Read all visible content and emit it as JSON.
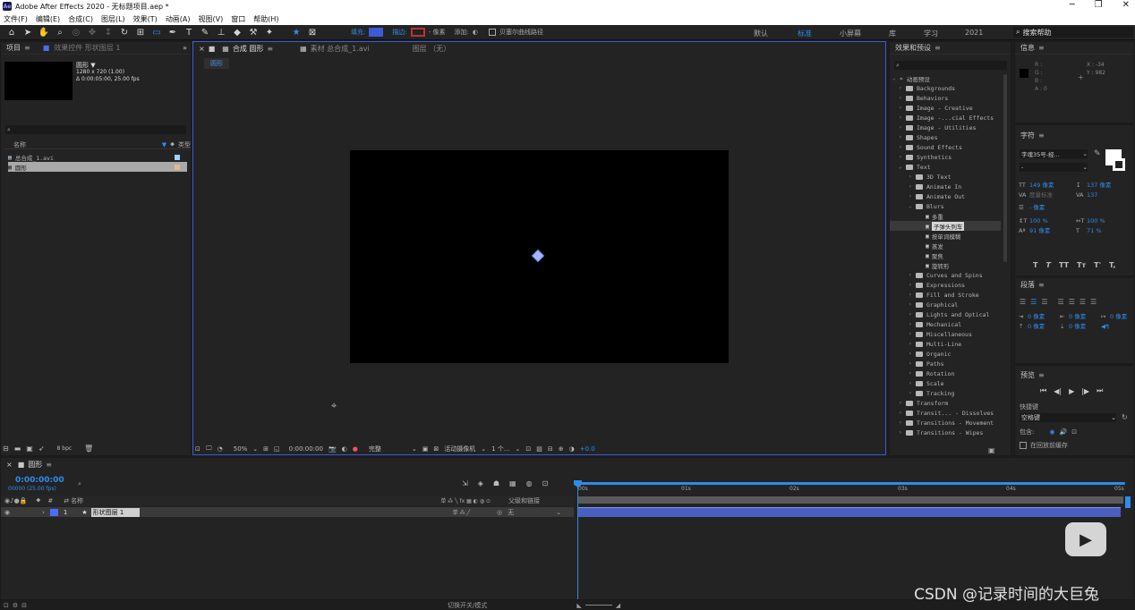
{
  "titlebar": {
    "title": "Adobe After Effects 2020 - 无标题项目.aep *",
    "logo": "Ae",
    "minimize": "─",
    "maximize": "❐",
    "close": "✕"
  },
  "menu": [
    "文件(F)",
    "编辑(E)",
    "合成(C)",
    "图层(L)",
    "效果(T)",
    "动画(A)",
    "视图(V)",
    "窗口",
    "帮助(H)"
  ],
  "toolbar": {
    "fill_label": "填充:",
    "stroke_label": "描边:",
    "stroke_px": "- 像素",
    "add_label": "添加:",
    "bezier_label": "贝塞尔曲线路径",
    "workspaces": [
      "默认",
      "标准",
      "小屏幕",
      "库",
      "学习",
      "2021"
    ],
    "active_workspace": "标准",
    "search_help": "搜索帮助"
  },
  "project": {
    "tab": "项目",
    "tab2": "效果控件 形状图层 1",
    "item_name": "圆形 ▼",
    "item_dims": "1280 x 720 (1.00)",
    "item_dur": "Δ 0:00:05:00, 25.00 fps",
    "search_placeholder": "",
    "col_name": "名称",
    "col_type": "类型",
    "items": [
      {
        "name": "总合成_1.avi",
        "icon": "video-file-icon",
        "selected": false
      },
      {
        "name": "圆形",
        "icon": "composition-icon",
        "selected": true
      }
    ],
    "bpc": "8 bpc"
  },
  "composition": {
    "tab": "合成 圆形",
    "tab2": "素材 总合成_1.avi",
    "tab3": "图层 （无）",
    "comp_label": "圆形",
    "zoom": "50%",
    "timecode": "0:00:00:00",
    "quality": "完整",
    "camera": "活动摄像机",
    "views": "1 个...",
    "exposure": "+0.0"
  },
  "effects": {
    "title": "效果和预设",
    "search_placeholder": "",
    "root": "* 动画预设",
    "tree": [
      {
        "label": "Backgrounds",
        "depth": 1,
        "open": false
      },
      {
        "label": "Behaviors",
        "depth": 1,
        "open": false
      },
      {
        "label": "Image - Creative",
        "depth": 1,
        "open": false
      },
      {
        "label": "Image -...cial Effects",
        "depth": 1,
        "open": false
      },
      {
        "label": "Image - Utilities",
        "depth": 1,
        "open": false
      },
      {
        "label": "Shapes",
        "depth": 1,
        "open": false
      },
      {
        "label": "Sound Effects",
        "depth": 1,
        "open": false
      },
      {
        "label": "Synthetics",
        "depth": 1,
        "open": false
      },
      {
        "label": "Text",
        "depth": 1,
        "open": true
      },
      {
        "label": "3D Text",
        "depth": 2,
        "open": false
      },
      {
        "label": "Animate In",
        "depth": 2,
        "open": false
      },
      {
        "label": "Animate Out",
        "depth": 2,
        "open": false
      },
      {
        "label": "Blurs",
        "depth": 2,
        "open": true
      },
      {
        "label": "多重",
        "depth": 3,
        "preset": true
      },
      {
        "label": "子弹头列车",
        "depth": 3,
        "preset": true,
        "selected": true
      },
      {
        "label": "按单词模糊",
        "depth": 3,
        "preset": true
      },
      {
        "label": "蒸发",
        "depth": 3,
        "preset": true
      },
      {
        "label": "聚焦",
        "depth": 3,
        "preset": true
      },
      {
        "label": "旋转形",
        "depth": 3,
        "preset": true
      },
      {
        "label": "Curves and Spins",
        "depth": 2,
        "open": false
      },
      {
        "label": "Expressions",
        "depth": 2,
        "open": false
      },
      {
        "label": "Fill and Stroke",
        "depth": 2,
        "open": false
      },
      {
        "label": "Graphical",
        "depth": 2,
        "open": false
      },
      {
        "label": "Lights and Optical",
        "depth": 2,
        "open": false
      },
      {
        "label": "Mechanical",
        "depth": 2,
        "open": false
      },
      {
        "label": "Miscellaneous",
        "depth": 2,
        "open": false
      },
      {
        "label": "Multi-Line",
        "depth": 2,
        "open": false
      },
      {
        "label": "Organic",
        "depth": 2,
        "open": false
      },
      {
        "label": "Paths",
        "depth": 2,
        "open": false
      },
      {
        "label": "Rotation",
        "depth": 2,
        "open": false
      },
      {
        "label": "Scale",
        "depth": 2,
        "open": false
      },
      {
        "label": "Tracking",
        "depth": 2,
        "open": false
      },
      {
        "label": "Transform",
        "depth": 1,
        "open": false
      },
      {
        "label": "Transit... - Dissolves",
        "depth": 1,
        "open": false
      },
      {
        "label": "Transitions - Movement",
        "depth": 1,
        "open": false
      },
      {
        "label": "Transitions - Wipes",
        "depth": 1,
        "open": false
      }
    ]
  },
  "info": {
    "title": "信息",
    "r": "R :",
    "g": "G :",
    "b": "B :",
    "a": "A : 0",
    "x": "X : -34",
    "y": "Y : 982"
  },
  "character": {
    "title": "字符",
    "font": "字魂35号-经...",
    "style": "-",
    "size": "149 像素",
    "leading": "137 像素",
    "kerning": "度量标准",
    "tracking": "137",
    "stroke": "- 像素",
    "vscale": "100 %",
    "hscale": "100 %",
    "baseline": "91 像素",
    "tsume": "71 %"
  },
  "paragraph": {
    "title": "段落",
    "indent1": "0 像素",
    "indent2": "0 像素",
    "indent3": "0 像素",
    "space1": "0 像素",
    "space2": "0 像素"
  },
  "preview": {
    "title": "预览",
    "shortcut_label": "快捷键",
    "shortcut": "空格键",
    "include_label": "包含:",
    "cache_label": "在回放前缓存"
  },
  "timeline": {
    "comp_tab": "圆形",
    "timecode": "0:00:00:00",
    "fps": "00000 (25.00 fps)",
    "col_name": "名称",
    "col_parent": "父级和链接",
    "layer_index": "1",
    "layer_name": "形状图层 1",
    "parent": "无",
    "ruler": [
      "00s",
      "01s",
      "02s",
      "03s",
      "04s",
      "05s"
    ],
    "footer_toggle": "切换开关/模式"
  },
  "watermark": "CSDN @记录时间的大巨兔",
  "colors": {
    "accent": "#2d8ceb",
    "layer_bar": "#4a5fc1",
    "panel": "#232323",
    "bg": "#1d1d1d"
  }
}
